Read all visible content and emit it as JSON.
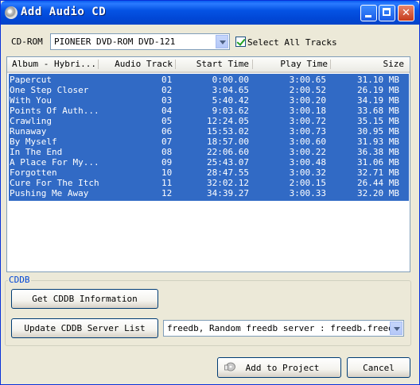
{
  "window": {
    "title": "Add Audio CD",
    "controls": {
      "minimize": "minimize",
      "maximize": "maximize",
      "close": "close"
    }
  },
  "cdrom": {
    "label": "CD-ROM",
    "selected": "PIONEER DVD-ROM DVD-121",
    "select_all_label": "Select All Tracks",
    "select_all_checked": true
  },
  "tracklist": {
    "columns": [
      "Album - Hybri...",
      "Audio Track",
      "Start Time",
      "Play Time",
      "Size"
    ],
    "rows": [
      [
        "Papercut",
        "01",
        "0:00.00",
        "3:00.65",
        "31.10 MB"
      ],
      [
        "One Step Closer",
        "02",
        "3:04.65",
        "2:00.52",
        "26.19 MB"
      ],
      [
        "With You",
        "03",
        "5:40.42",
        "3:00.20",
        "34.19 MB"
      ],
      [
        "Points Of Auth...",
        "04",
        "9:03.62",
        "3:00.18",
        "33.68 MB"
      ],
      [
        "Crawling",
        "05",
        "12:24.05",
        "3:00.72",
        "35.15 MB"
      ],
      [
        "Runaway",
        "06",
        "15:53.02",
        "3:00.73",
        "30.95 MB"
      ],
      [
        "By Myself",
        "07",
        "18:57.00",
        "3:00.60",
        "31.93 MB"
      ],
      [
        "In The End",
        "08",
        "22:06.60",
        "3:00.22",
        "36.38 MB"
      ],
      [
        "A Place For My...",
        "09",
        "25:43.07",
        "3:00.48",
        "31.06 MB"
      ],
      [
        "Forgotten",
        "10",
        "28:47.55",
        "3:00.32",
        "32.71 MB"
      ],
      [
        "Cure For The Itch",
        "11",
        "32:02.12",
        "2:00.15",
        "26.44 MB"
      ],
      [
        "Pushing Me Away",
        "12",
        "34:39.27",
        "3:00.33",
        "32.20 MB"
      ]
    ]
  },
  "cddb": {
    "group_label": "CDDB",
    "get_info_label": "Get CDDB Information",
    "update_server_label": "Update CDDB Server List",
    "server_selected": "freedb, Random freedb server : freedb.freedb."
  },
  "footer": {
    "add_label": "Add to Project",
    "cancel_label": "Cancel"
  },
  "colors": {
    "titlebar": "#0553e4",
    "selection": "#316ac5",
    "window_bg": "#ece9d8",
    "group_title": "#0046d5"
  }
}
